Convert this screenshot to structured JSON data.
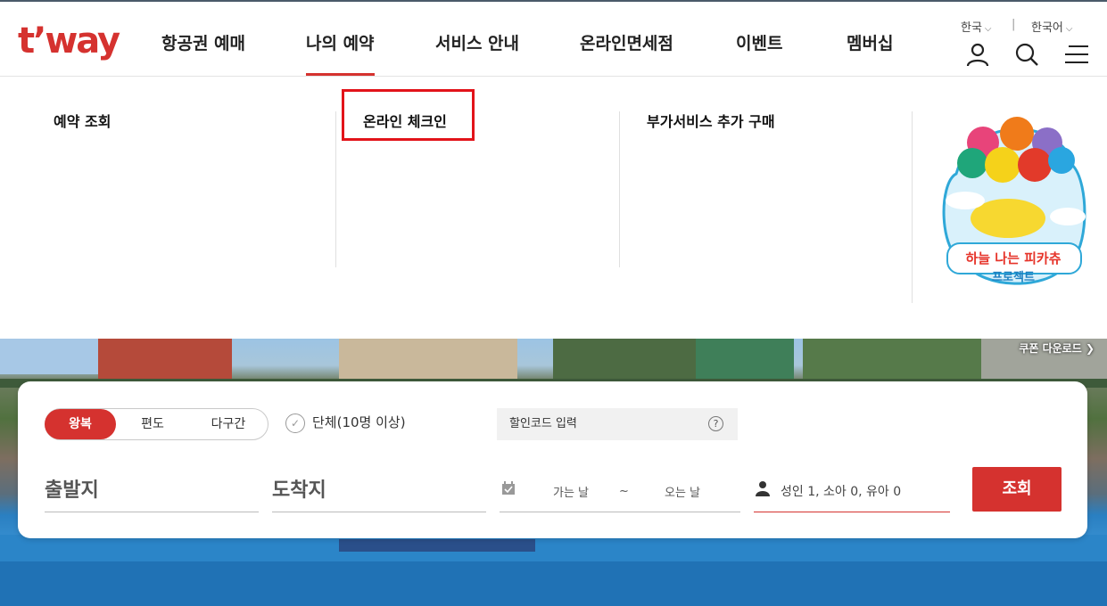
{
  "brand": {
    "logo_text": "t’way",
    "accent": "#d5322f"
  },
  "nav": {
    "items": [
      {
        "label": "항공권 예매"
      },
      {
        "label": "나의 예약"
      },
      {
        "label": "서비스 안내"
      },
      {
        "label": "온라인면세점"
      },
      {
        "label": "이벤트"
      },
      {
        "label": "멤버십"
      }
    ],
    "active": "나의 예약"
  },
  "header_util": {
    "country": "한국",
    "language": "한국어",
    "separator": "|",
    "icons": [
      "user-icon",
      "search-icon",
      "menu-icon"
    ]
  },
  "mega_menu": {
    "columns": [
      {
        "title": "예약 조회"
      },
      {
        "title": "온라인 체크인"
      },
      {
        "title": "부가서비스 추가 구매"
      }
    ],
    "promo": {
      "line1": "하늘 나는 피카츄",
      "line2": "프로젝트"
    }
  },
  "hero": {
    "coupon_link": "쿠폰 다운로드"
  },
  "search": {
    "trip_types": [
      "왕복",
      "편도",
      "다구간"
    ],
    "selected_trip": "왕복",
    "group_label": "단체(10명 이상)",
    "promo_code_placeholder": "할인코드 입력",
    "help": "?",
    "origin_label": "출발지",
    "destination_label": "도착지",
    "depart_label": "가는 날",
    "date_sep": "~",
    "return_label": "오는 날",
    "passengers": "성인 1, 소아 0, 유아 0",
    "submit_label": "조회"
  }
}
